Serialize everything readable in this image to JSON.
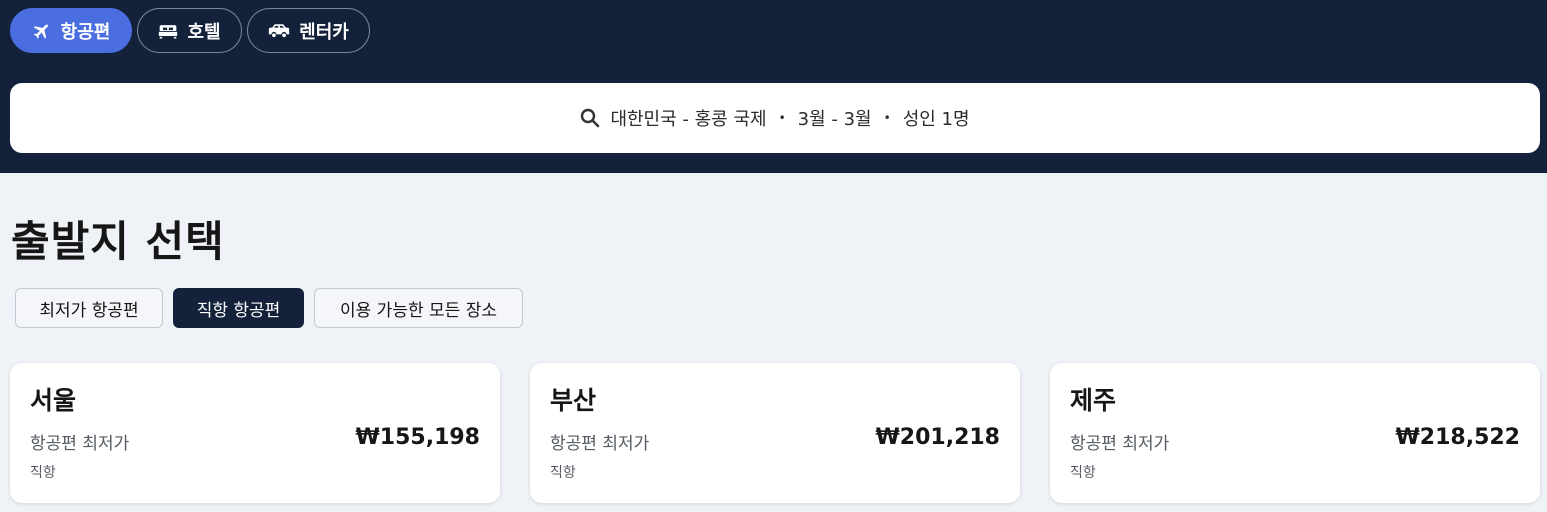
{
  "nav": {
    "tabs": [
      {
        "label": "항공편",
        "icon": "airplane-icon",
        "active": true
      },
      {
        "label": "호텔",
        "icon": "bed-icon",
        "active": false
      },
      {
        "label": "렌터카",
        "icon": "car-icon",
        "active": false
      }
    ]
  },
  "search": {
    "route": "대한민국 - 홍콩 국제",
    "dates": "3월 - 3월",
    "travelers": "성인 1명",
    "separator": "•",
    "icon": "search-icon"
  },
  "page_title": "출발지 선택",
  "filters": [
    {
      "label": "최저가 항공편",
      "active": false
    },
    {
      "label": "직항 항공편",
      "active": true
    },
    {
      "label": "이용 가능한 모든 장소",
      "active": false
    }
  ],
  "cards": [
    {
      "city": "서울",
      "label": "항공편 최저가",
      "price": "₩155,198",
      "note": "직항"
    },
    {
      "city": "부산",
      "label": "항공편 최저가",
      "price": "₩201,218",
      "note": "직항"
    },
    {
      "city": "제주",
      "label": "항공편 최저가",
      "price": "₩218,522",
      "note": "직항"
    }
  ],
  "colors": {
    "header_bg": "#13213a",
    "accent": "#4a6ee0",
    "page_bg": "#eff3f8"
  }
}
